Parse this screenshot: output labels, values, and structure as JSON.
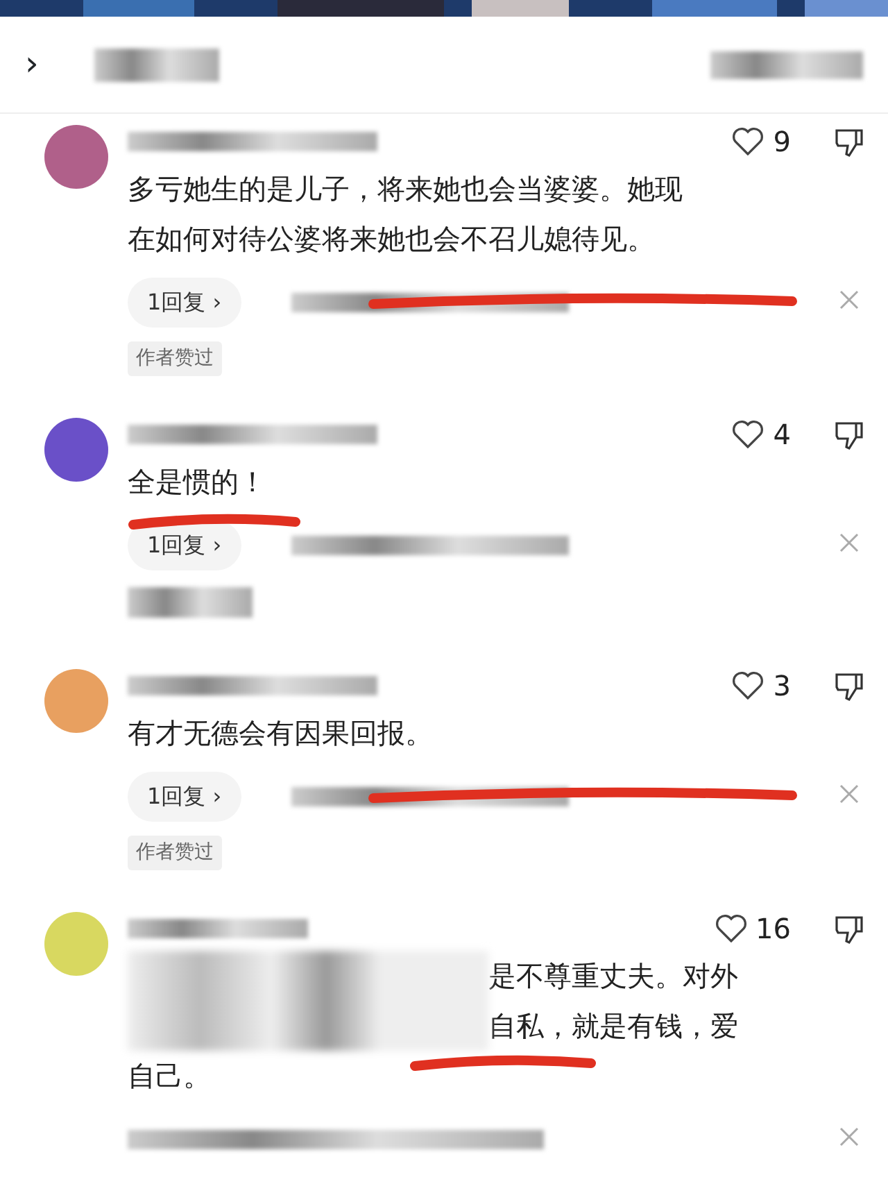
{
  "header": {
    "back": "›"
  },
  "comments": [
    {
      "color": "#b0608a",
      "likes": "9",
      "text_lines": [
        "多亏她生的是儿子，将来她也会当婆婆。她现",
        "在如何对待公婆将来她也会不召儿媳待见。"
      ],
      "text_indent": false,
      "reply": "1回复 ›",
      "author_liked": "作者赞过",
      "hidden_row": false,
      "underline": {
        "kind": "reply-row"
      }
    },
    {
      "color": "#6a50c8",
      "likes": "4",
      "text_lines": [
        "全是惯的！"
      ],
      "text_indent": false,
      "reply": "1回复 ›",
      "hidden_row": true,
      "underline": {
        "kind": "text"
      }
    },
    {
      "color": "#e8a060",
      "likes": "3",
      "text_lines": [
        "有才无德会有因果回报。"
      ],
      "text_indent": false,
      "reply": "1回复 ›",
      "author_liked": "作者赞过",
      "hidden_row": false,
      "underline": {
        "kind": "reply-row"
      }
    },
    {
      "color": "#d8d860",
      "likes": "16",
      "text_lines": [
        "是不尊重丈夫。对外",
        "自私，就是有钱，爱",
        "自己。"
      ],
      "text_indent": true,
      "hidden_row": true,
      "underline": {
        "kind": "between"
      }
    }
  ]
}
